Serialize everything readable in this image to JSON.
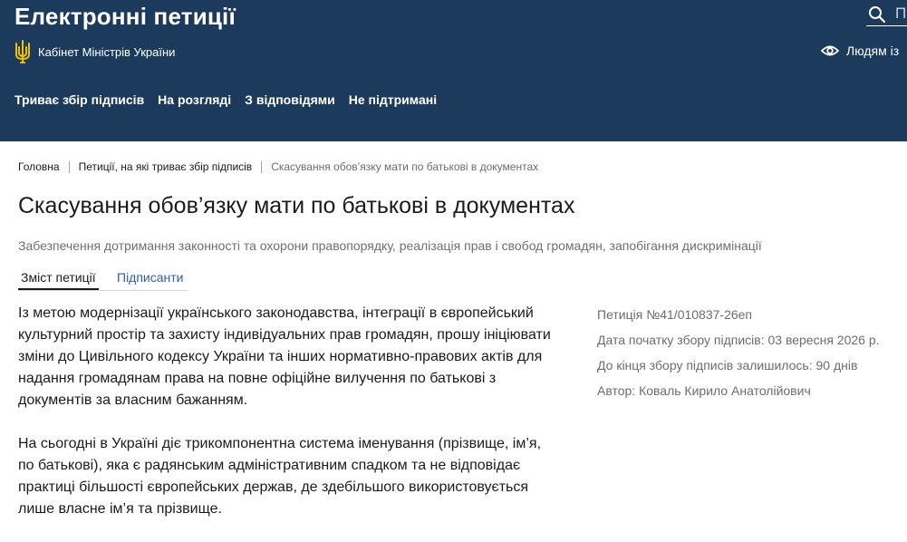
{
  "header": {
    "site_title": "Електронні петиції",
    "org_name": "Кабінет Міністрів України",
    "search_placeholder": "По",
    "accessibility_label": "Людям із",
    "colors": {
      "header_bg": "#1b3a5c",
      "emblem": "#f2c200"
    },
    "icons": {
      "emblem": "trident-emblem-icon",
      "search": "search-icon",
      "eye": "eye-icon"
    }
  },
  "nav": {
    "items": [
      {
        "label": "Триває збір підписів"
      },
      {
        "label": "На розгляді"
      },
      {
        "label": "З відповідями"
      },
      {
        "label": "Не підтримані"
      }
    ]
  },
  "breadcrumb": {
    "items": [
      {
        "label": "Головна"
      },
      {
        "label": "Петиції, на які триває збір підписів"
      },
      {
        "label": "Скасування обов’язку мати по батькові в документах"
      }
    ]
  },
  "petition": {
    "title": "Скасування обов’язку мати по батькові в документах",
    "category": "Забезпечення дотримання законності та охорони правопорядку, реалізація прав і свобод громадян, запобігання дискримінації",
    "tabs": [
      {
        "label": "Зміст петиції",
        "active": true
      },
      {
        "label": "Підписанти",
        "active": false
      }
    ],
    "paragraphs": [
      "Із метою модернізації українського законодавства, інтеграції в європейський культурний простір та захисту індивідуальних прав громадян, прошу ініціювати зміни до Цивільного кодексу України та інших нормативно-правових актів для надання громадянам права на повне офіційне вилучення по батькові з документів за власним бажанням.",
      "На сьогодні в Україні діє трикомпонентна система іменування (прізвище, ім’я, по батькові), яка є радянським адміністративним спадком та не відповідає практиці більшості європейських держав, де здебільшого використовується лише власне ім’я та прізвище."
    ],
    "meta": {
      "number": "Петиція №41/010837-26еп",
      "start_date": "Дата початку збору підписів: 03 вересня 2026 р.",
      "days_left": "До кінця збору підписів залишилось: 90 днів",
      "author": "Автор: Коваль Кирило Анатолійович"
    }
  }
}
